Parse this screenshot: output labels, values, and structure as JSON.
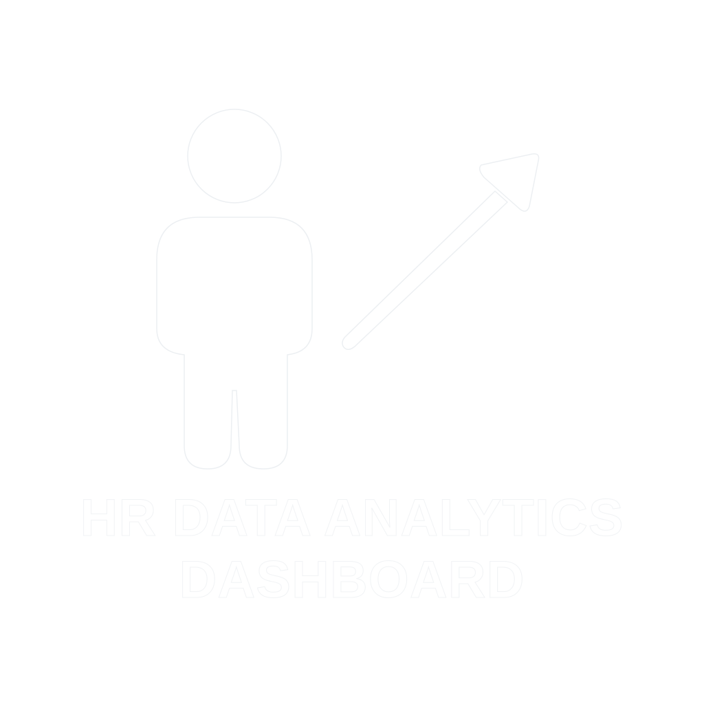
{
  "title": {
    "line1": "HR DATA ANALYTICS",
    "line2": "DASHBOARD"
  },
  "icons": {
    "person": "person-icon",
    "arrow": "trend-up-arrow-icon"
  },
  "colors": {
    "background": "#ffffff",
    "fill": "#ffffff",
    "outline": "#eceff2"
  }
}
